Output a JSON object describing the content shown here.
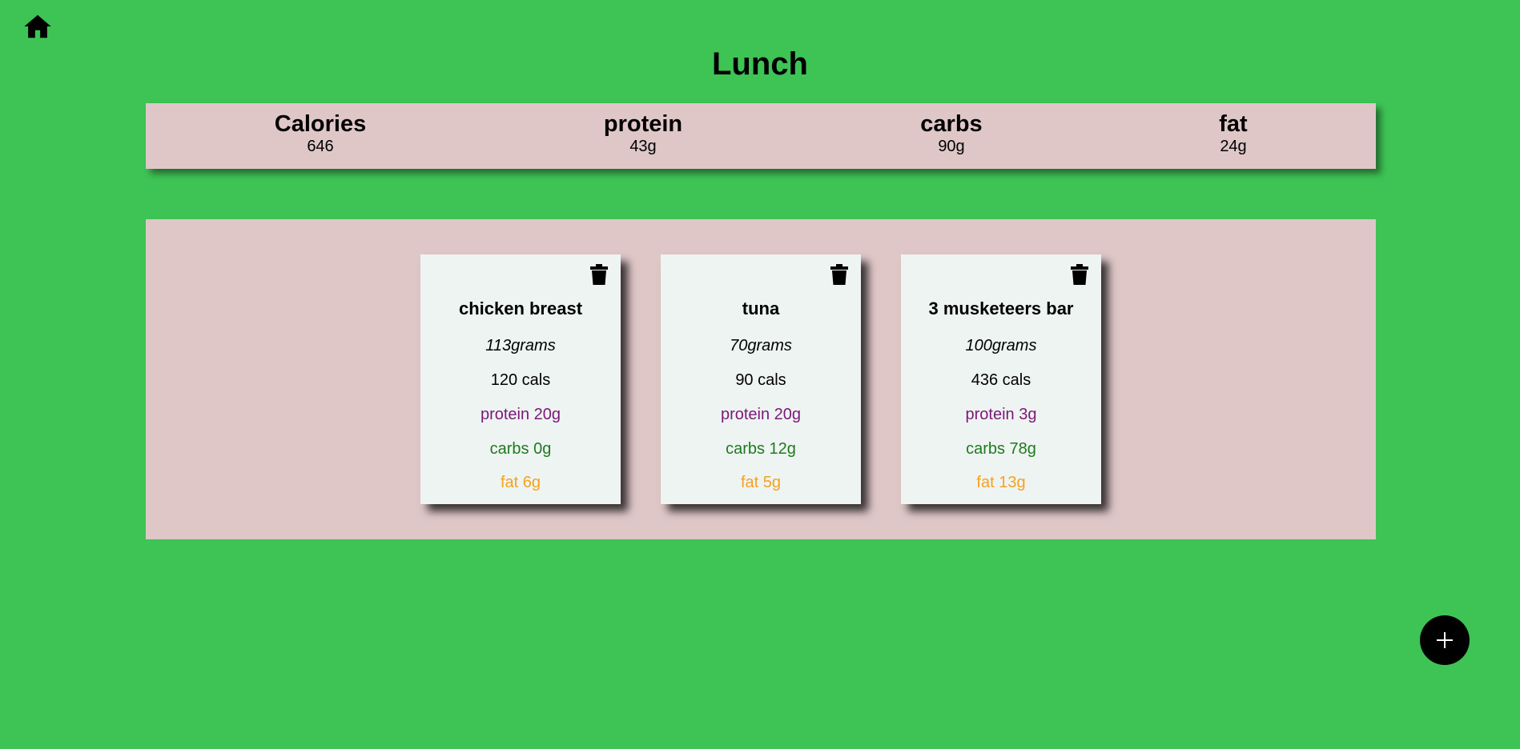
{
  "header": {
    "home_icon": "home-icon",
    "title": "Lunch"
  },
  "totals": [
    {
      "label": "Calories",
      "value": "646"
    },
    {
      "label": "protein",
      "value": "43g"
    },
    {
      "label": "carbs",
      "value": "90g"
    },
    {
      "label": "fat",
      "value": "24g"
    }
  ],
  "foods": [
    {
      "name": "chicken breast",
      "grams": "113grams",
      "cals": "120 cals",
      "protein": "protein 20g",
      "carbs": "carbs 0g",
      "fat": "fat 6g",
      "delete_icon": "trash-icon"
    },
    {
      "name": "tuna",
      "grams": "70grams",
      "cals": "90 cals",
      "protein": "protein 20g",
      "carbs": "carbs 12g",
      "fat": "fat 5g",
      "delete_icon": "trash-icon"
    },
    {
      "name": "3 musketeers bar",
      "grams": "100grams",
      "cals": "436 cals",
      "protein": "protein 3g",
      "carbs": "carbs 78g",
      "fat": "fat 13g",
      "delete_icon": "trash-icon"
    }
  ],
  "add_button": {
    "icon": "plus-icon"
  },
  "colors": {
    "background": "#3ec355",
    "panel": "#dfc7c8",
    "card": "#eef4f2",
    "protein": "#7b1878",
    "carbs": "#1f7a1f",
    "fat": "#f5a21f"
  }
}
